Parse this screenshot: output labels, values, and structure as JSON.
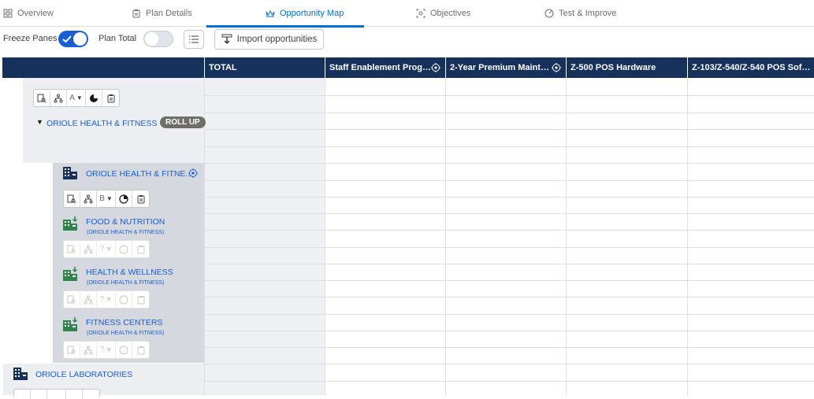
{
  "tabs": [
    {
      "label": "Overview",
      "icon": "grid-icon"
    },
    {
      "label": "Plan Details",
      "icon": "clipboard-icon"
    },
    {
      "label": "Opportunity Map",
      "icon": "crown-icon",
      "active": true
    },
    {
      "label": "Objectives",
      "icon": "target-icon"
    },
    {
      "label": "Test & Improve",
      "icon": "gauge-icon"
    }
  ],
  "toolbar": {
    "freeze_label": "Freeze Panes",
    "freeze_on": true,
    "plan_total_label": "Plan Total",
    "plan_total_on": false,
    "import_label": "Import opportunities"
  },
  "grid": {
    "columns": [
      {
        "label": "TOTAL"
      },
      {
        "label": "Staff Enablement Progr...",
        "target": true
      },
      {
        "label": "2-Year Premium Mainte...",
        "target": true
      },
      {
        "label": "Z-500 POS Hardware"
      },
      {
        "label": "Z-103/Z-540/Z-540 POS Soft..."
      }
    ]
  },
  "tree": {
    "root_iconbar_letter": "A",
    "root_name": "ORIOLE HEALTH & FITNESS",
    "rollup_label": "ROLL UP",
    "child_main": {
      "name": "ORIOLE HEALTH & FITNE...",
      "iconbar_letter": "B"
    },
    "children": [
      {
        "name": "FOOD & NUTRITION",
        "parent": "(ORIOLE HEALTH & FITNESS)"
      },
      {
        "name": "HEALTH & WELLNESS",
        "parent": "(ORIOLE HEALTH & FITNESS)"
      },
      {
        "name": "FITNESS CENTERS",
        "parent": "(ORIOLE HEALTH & FITNESS)"
      }
    ],
    "next_root": "ORIOLE LABORATORIES",
    "disabled_letter": "?"
  },
  "colors": {
    "accent": "#1b5ed4",
    "header": "#16325c",
    "tab_active": "#0070d2"
  }
}
